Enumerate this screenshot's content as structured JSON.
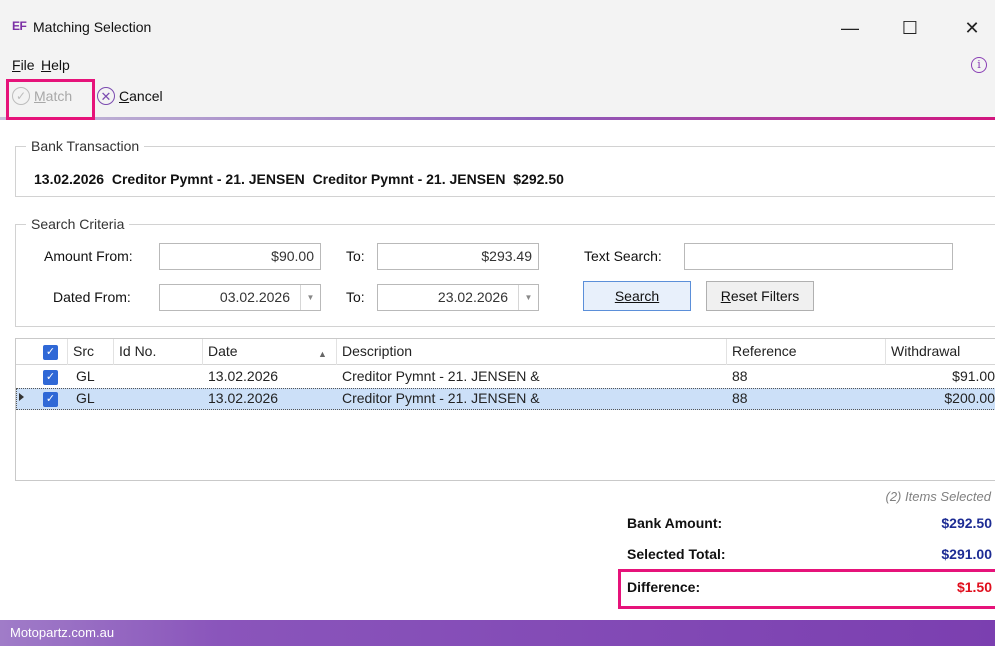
{
  "window": {
    "app_icon_text": "EF",
    "title": "Matching Selection",
    "minimize": "—",
    "maximize": "☐",
    "close": "✕"
  },
  "menu": {
    "file_mnemonic": "F",
    "file_rest": "ile",
    "help_mnemonic": "H",
    "help_rest": "elp",
    "info_glyph": "i"
  },
  "toolbar": {
    "match_check": "✓",
    "match_mnemonic": "M",
    "match_rest": "atch",
    "cancel_x": "✕",
    "cancel_mnemonic": "C",
    "cancel_rest": "ancel"
  },
  "bank_transaction": {
    "label": "Bank Transaction",
    "text": "13.02.2026  Creditor Pymnt - 21. JENSEN  Creditor Pymnt - 21. JENSEN  $292.50"
  },
  "search": {
    "label": "Search Criteria",
    "amount_from_label": "Amount From:",
    "amount_from": "$90.00",
    "amount_to_label": "To:",
    "amount_to": "$293.49",
    "text_search_label": "Text Search:",
    "text_search": "",
    "dated_from_label": "Dated From:",
    "dated_from": "03.02.2026",
    "dated_to_label": "To:",
    "dated_to": "23.02.2026",
    "dropdown_glyph": "▼",
    "search_button": "Search",
    "search_mnemonic": "S",
    "search_rest": "earch",
    "reset_mnemonic": "R",
    "reset_rest": "eset Filters"
  },
  "grid": {
    "check_glyph": "✓",
    "sort_glyph": "▲",
    "columns": {
      "src": "Src",
      "id": "Id No.",
      "date": "Date",
      "description": "Description",
      "reference": "Reference",
      "withdrawal": "Withdrawal"
    },
    "rows": [
      {
        "src": "GL",
        "id": "",
        "date": "13.02.2026",
        "description": "Creditor Pymnt - 21. JENSEN &",
        "reference": "88",
        "withdrawal": "$91.00"
      },
      {
        "src": "GL",
        "id": "",
        "date": "13.02.2026",
        "description": "Creditor Pymnt - 21. JENSEN &",
        "reference": "88",
        "withdrawal": "$200.00"
      }
    ]
  },
  "summary": {
    "items_selected": "(2) Items Selected",
    "bank_amount_label": "Bank Amount:",
    "bank_amount": "$292.50",
    "selected_total_label": "Selected Total:",
    "selected_total": "$291.00",
    "difference_label": "Difference:",
    "difference": "$1.50"
  },
  "status_bar": {
    "text": "Motopartz.com.au"
  },
  "colors": {
    "accent_purple": "#7b3fb0",
    "highlight_pink": "#e6137a",
    "total_blue": "#1d2c94",
    "difference_red": "#e00e1d"
  }
}
